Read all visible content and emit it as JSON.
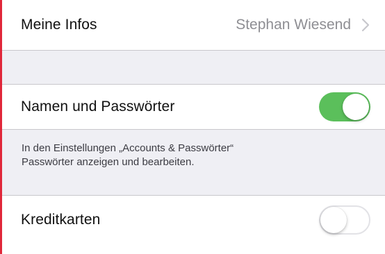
{
  "settings": {
    "my_info": {
      "label": "Meine Infos",
      "value": "Stephan Wiesend",
      "icon": "chevron-right-icon"
    },
    "names_passwords": {
      "label": "Namen und Passwörter",
      "toggle_on": true,
      "toggle_color": "#5bbf5b"
    },
    "footnote": {
      "line1": "In den Einstellungen „Accounts & Passwörter“",
      "line2": "Passwörter anzeigen und bearbeiten."
    },
    "credit_cards": {
      "label": "Kreditkarten",
      "toggle_on": false
    }
  },
  "colors": {
    "group_background": "#efeff4",
    "separator": "#c8c7cc",
    "frame_accent": "#e0273a",
    "secondary_text": "#8e8e93"
  }
}
